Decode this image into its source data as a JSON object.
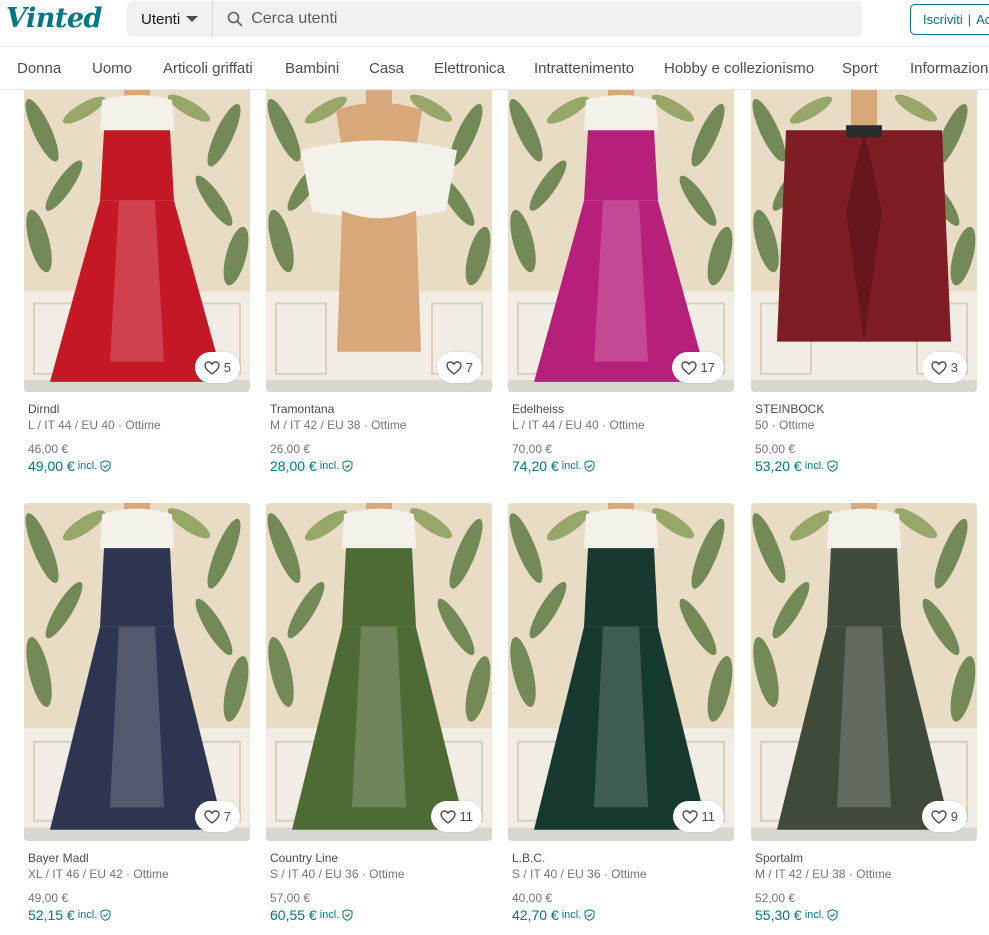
{
  "brand": {
    "logo": "Vinted"
  },
  "search": {
    "type_label": "Utenti",
    "placeholder": "Cerca utenti"
  },
  "auth": {
    "signup": "Iscriviti",
    "login": "Accedi"
  },
  "categories": [
    "Donna",
    "Uomo",
    "Articoli griffati",
    "Bambini",
    "Casa",
    "Elettronica",
    "Intrattenimento",
    "Hobby e collezionismo",
    "Sport",
    "Informazioni"
  ],
  "items": [
    {
      "brand": "Dirndl",
      "size": "L / IT 44 / EU 40 · Ottime",
      "price": "46,00 €",
      "total": "49,00 €",
      "incl": "incl.",
      "favorites": "5",
      "garment_color": "#c41826",
      "icon": "dress-photo"
    },
    {
      "brand": "Tramontana",
      "size": "M / IT 42 / EU 38 · Ottime",
      "price": "26,00 €",
      "total": "28,00 €",
      "incl": "incl.",
      "favorites": "7",
      "garment_color": "#f4f1ea",
      "icon": "blouse-photo"
    },
    {
      "brand": "Edelheiss",
      "size": "L / IT 44 / EU 40 · Ottime",
      "price": "70,00 €",
      "total": "74,20 €",
      "incl": "incl.",
      "favorites": "17",
      "garment_color": "#b7207a",
      "icon": "dress-photo"
    },
    {
      "brand": "STEINBOCK",
      "size": "50 · Ottime",
      "price": "50,00 €",
      "total": "53,20 €",
      "incl": "incl.",
      "favorites": "3",
      "garment_color": "#7e1d24",
      "icon": "jacket-photo"
    },
    {
      "brand": "Bayer Madl",
      "size": "XL / IT 46 / EU 42 · Ottime",
      "price": "49,00 €",
      "total": "52,15 €",
      "incl": "incl.",
      "favorites": "7",
      "garment_color": "#2d3550",
      "icon": "dress-photo"
    },
    {
      "brand": "Country Line",
      "size": "S / IT 40 / EU 36 · Ottime",
      "price": "57,00 €",
      "total": "60,55 €",
      "incl": "incl.",
      "favorites": "11",
      "garment_color": "#4f6b35",
      "icon": "dress-photo"
    },
    {
      "brand": "L.B.C.",
      "size": "S / IT 40 / EU 36 · Ottime",
      "price": "40,00 €",
      "total": "42,70 €",
      "incl": "incl.",
      "favorites": "11",
      "garment_color": "#163a30",
      "icon": "dress-photo"
    },
    {
      "brand": "Sportalm",
      "size": "M / IT 42 / EU 38 · Ottime",
      "price": "52,00 €",
      "total": "55,30 €",
      "incl": "incl.",
      "favorites": "9",
      "garment_color": "#3f4a3a",
      "icon": "dress-photo"
    }
  ],
  "colors": {
    "accent": "#007782",
    "wallpaper": "#e6d6b8",
    "leaf": "#5d7a45"
  }
}
